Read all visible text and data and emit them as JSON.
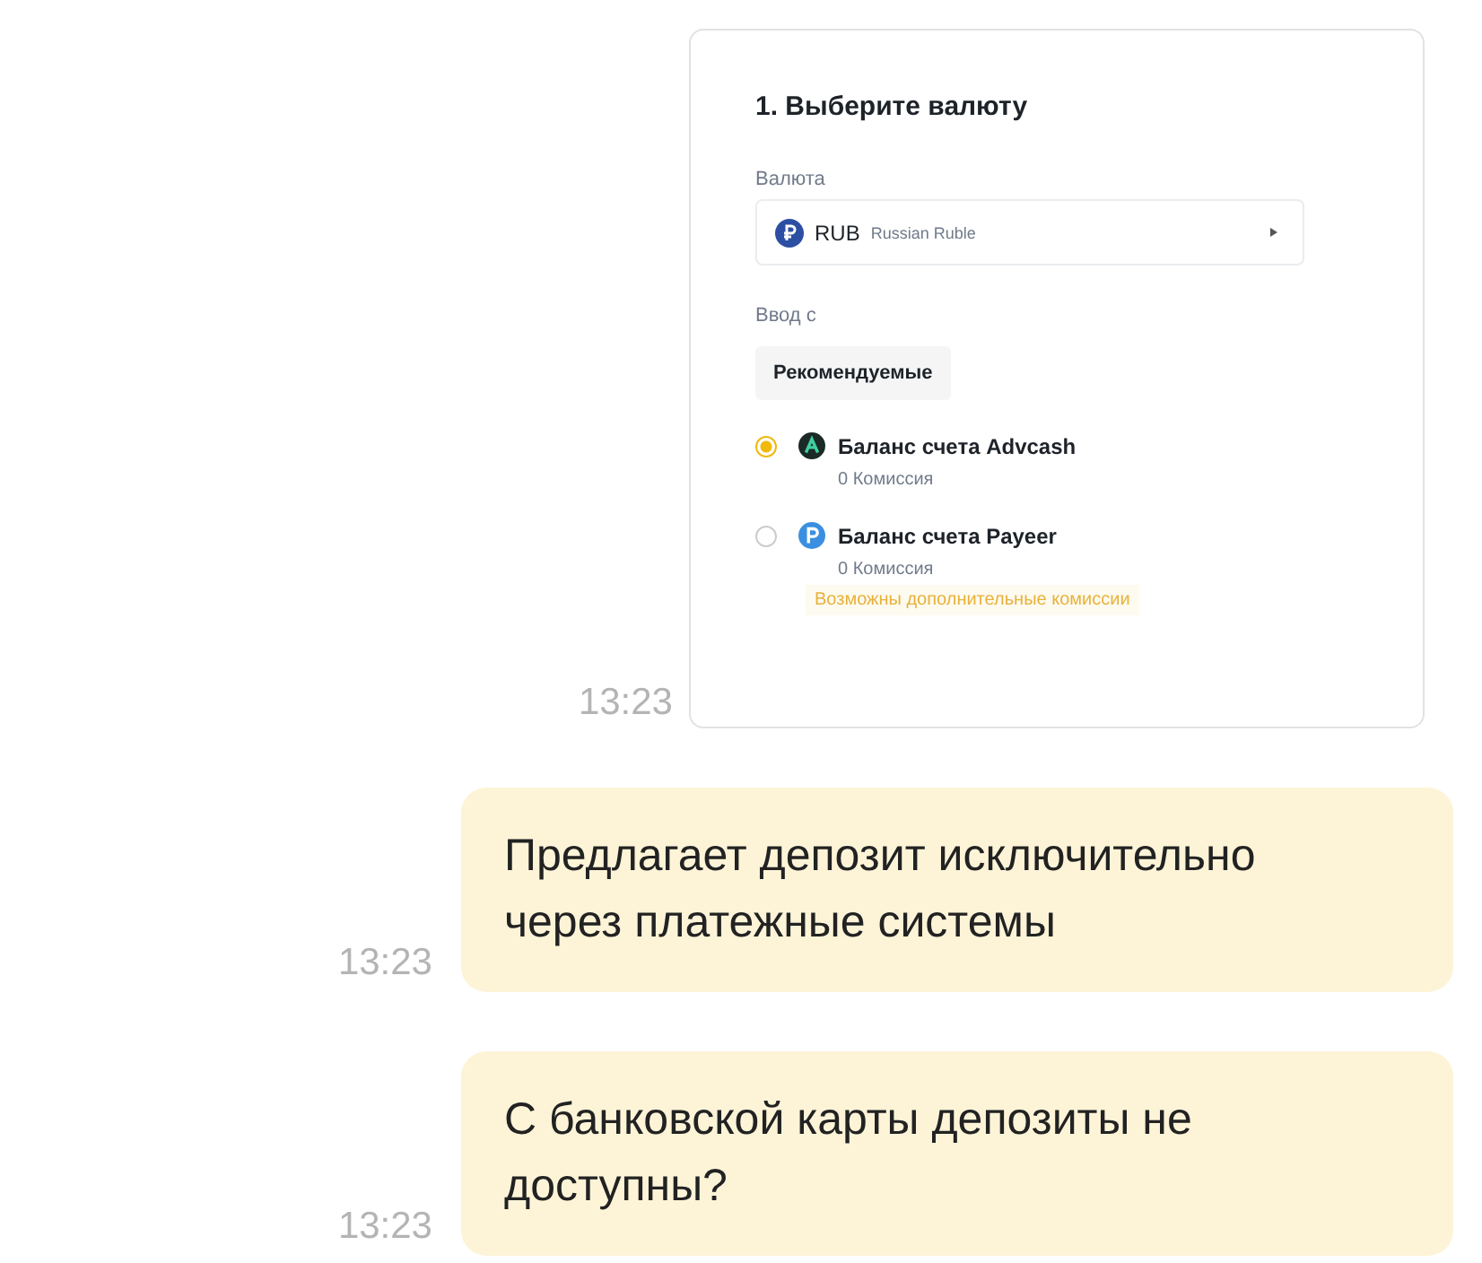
{
  "messages": [
    {
      "kind": "screenshot",
      "time": "13:23",
      "card": {
        "title": "1. Выберите валюту",
        "currency_label": "Валюта",
        "currency": {
          "code": "RUB",
          "name": "Russian Ruble"
        },
        "source_label": "Ввод с",
        "filter_chip": "Рекомендуемые",
        "options": [
          {
            "name": "Баланс счета Advcash",
            "fee": "0 Комиссия",
            "selected": true,
            "kind": "advcash"
          },
          {
            "name": "Баланс счета Payeer",
            "fee": "0 Комиссия",
            "selected": false,
            "kind": "payeer",
            "warning": "Возможны дополнительные комиссии"
          }
        ]
      }
    },
    {
      "kind": "text",
      "time": "13:23",
      "text": "Предлагает депозит исключительно через платежные системы"
    },
    {
      "kind": "text",
      "time": "13:23",
      "text": "С банковской карты депозиты не доступны?"
    }
  ]
}
